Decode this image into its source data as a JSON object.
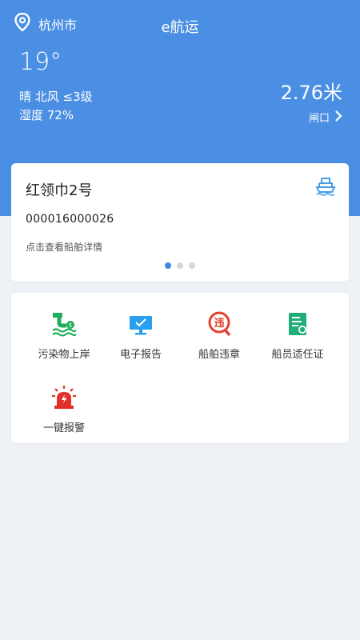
{
  "header": {
    "city": "杭州市",
    "app_title": "e航运",
    "temperature": "19°",
    "weather_line": "晴  北风  ≤3级",
    "humidity_line": "湿度    72%",
    "water_level": "2.76米",
    "gate_label": "闸口",
    "colors": {
      "background": "#4a8fe3",
      "text": "#ffffff"
    }
  },
  "ship_card": {
    "name": "红领巾2号",
    "id": "000016000026",
    "detail_link": "点击查看船舶详情",
    "carousel": {
      "pages": 3,
      "active": 1
    }
  },
  "functions": [
    {
      "label": "污染物上岸",
      "icon": "pollution-discharge-icon",
      "color": "#1fae5a"
    },
    {
      "label": "电子报告",
      "icon": "monitor-report-icon",
      "color": "#29a0ee"
    },
    {
      "label": "船舶违章",
      "icon": "violation-icon",
      "color": "#e0432f"
    },
    {
      "label": "船员适任证",
      "icon": "certificate-icon",
      "color": "#1fae7a"
    },
    {
      "label": "一键报警",
      "icon": "alarm-light-icon",
      "color": "#e0302a"
    }
  ]
}
